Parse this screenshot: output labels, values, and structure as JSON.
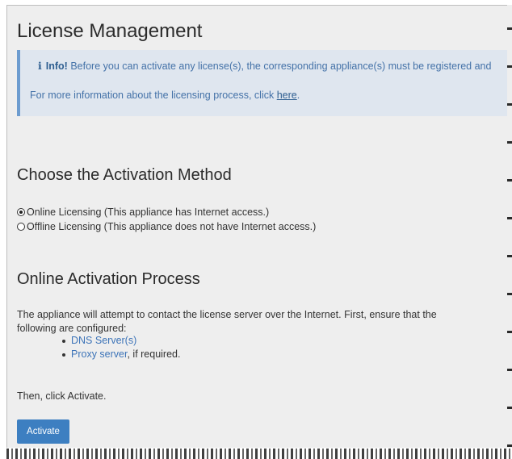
{
  "page": {
    "title": "License Management"
  },
  "info_box": {
    "icon": "info-icon",
    "icon_glyph": "i",
    "strong": "Info!",
    "message": "Before you can activate any license(s), the corresponding appliance(s) must be registered and",
    "more_text": "For more information about the licensing process, click",
    "more_link": "here",
    "more_suffix": "."
  },
  "activation_method": {
    "heading": "Choose the Activation Method",
    "options": [
      {
        "label": "Online Licensing (This appliance has Internet access.)",
        "selected": true
      },
      {
        "label": "Offline Licensing (This appliance does not have Internet access.)",
        "selected": false
      }
    ]
  },
  "online_process": {
    "heading": "Online Activation Process",
    "description": "The appliance will attempt to contact the license server over the Internet. First, ensure that the following are configured:",
    "items": [
      {
        "link": "DNS Server(s)",
        "suffix": ""
      },
      {
        "link": "Proxy server",
        "suffix": ", if required."
      }
    ],
    "then_text": "Then, click Activate.",
    "activate_label": "Activate"
  },
  "colors": {
    "page_background": "#eeeeee",
    "info_background": "#dfe6ef",
    "info_border": "#6d9ccf",
    "link": "#3d74b8",
    "button": "#3d7fc1"
  }
}
